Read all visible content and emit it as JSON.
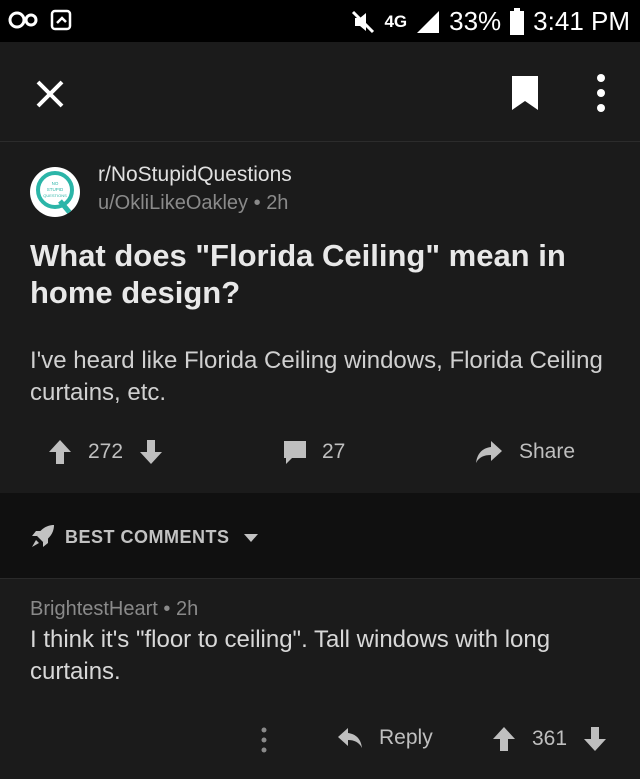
{
  "status_bar": {
    "network": "4G",
    "battery": "33%",
    "time": "3:41 PM"
  },
  "toolbar": {
    "close_icon": "close-icon",
    "bookmark_icon": "bookmark-icon",
    "more_icon": "more-vertical-icon"
  },
  "post": {
    "subreddit": "r/NoStupidQuestions",
    "author": "u/OkliLikeOakley",
    "age": "2h",
    "title": "What does \"Florida Ceiling\" mean in home design?",
    "body": "I've heard like Florida Ceiling windows, Florida Ceiling curtains, etc.",
    "score": "272",
    "comments": "27",
    "share_label": "Share",
    "icon_text": "NO STUPID QUESTIONS"
  },
  "sort": {
    "label": "BEST COMMENTS"
  },
  "comment": {
    "author": "BrightestHeart",
    "age": "2h",
    "body": "I think it's \"floor to ceiling\". Tall windows with long curtains.",
    "reply_label": "Reply",
    "score": "361"
  },
  "colors": {
    "background": "#1b1b1b",
    "sort_bar": "#101010",
    "accent_teal": "#2bb5a8",
    "text": "#e6e6e6",
    "meta": "#8a8a8a"
  }
}
